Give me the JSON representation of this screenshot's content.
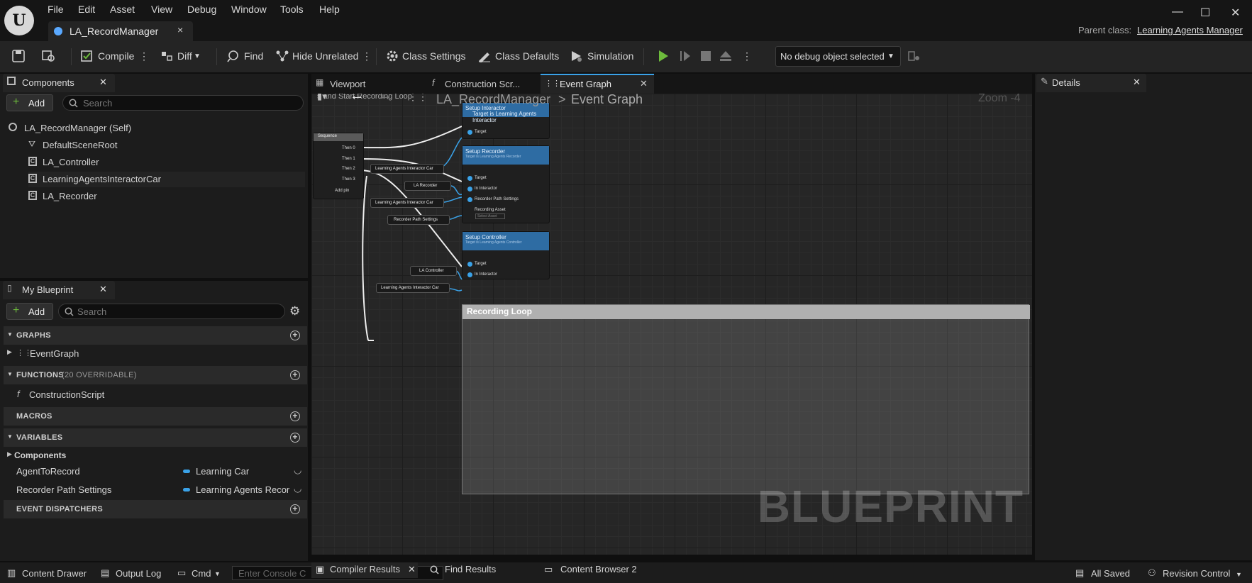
{
  "menu": [
    "File",
    "Edit",
    "Asset",
    "View",
    "Debug",
    "Window",
    "Tools",
    "Help"
  ],
  "doc_tab": {
    "label": "LA_RecordManager",
    "close": "×"
  },
  "parent_class": {
    "label": "Parent class:",
    "value": "Learning Agents Manager"
  },
  "window_buttons": {
    "minimize": "—",
    "maximize": "☐",
    "close": "✕"
  },
  "toolbar": {
    "compile": "Compile",
    "diff": "Diff",
    "find": "Find",
    "hide_unrelated": "Hide Unrelated",
    "class_settings": "Class Settings",
    "class_defaults": "Class Defaults",
    "simulation": "Simulation",
    "debug_object": "No debug object selected"
  },
  "components_panel": {
    "tab": "Components",
    "add": "Add",
    "search_placeholder": "Search",
    "items": [
      "LA_RecordManager (Self)",
      "DefaultSceneRoot",
      "LA_Controller",
      "LearningAgentsInteractorCar",
      "LA_Recorder"
    ]
  },
  "my_blueprint": {
    "tab": "My Blueprint",
    "add": "Add",
    "search_placeholder": "Search",
    "graphs": {
      "header": "GRAPHS",
      "items": [
        "EventGraph"
      ]
    },
    "functions": {
      "header": "FUNCTIONS",
      "count": "(20 OVERRIDABLE)",
      "items": [
        "ConstructionScript"
      ]
    },
    "macros": {
      "header": "MACROS"
    },
    "variables": {
      "header": "VARIABLES",
      "category": "Components",
      "items": [
        {
          "name": "AgentToRecord",
          "type": "Learning Car"
        },
        {
          "name": "Recorder Path Settings",
          "type": "Learning Agents Recor"
        }
      ]
    },
    "dispatchers": {
      "header": "EVENT DISPATCHERS"
    }
  },
  "editor_tabs": [
    {
      "label": "Viewport"
    },
    {
      "label": "Construction Scr..."
    },
    {
      "label": "Event Graph"
    }
  ],
  "details_tab": "Details",
  "graph": {
    "breadcrumb_root": "LA_RecordManager",
    "breadcrumb_sep": ">",
    "breadcrumb_leaf": "Event Graph",
    "zoom": "Zoom -4",
    "comment_fragment": "s and Start Recording Loop",
    "sequence": {
      "title": "Sequence",
      "pins": [
        "Then 0",
        "Then 1",
        "Then 2",
        "Then 3"
      ],
      "add_pin": "Add pin"
    },
    "setup_interactor": {
      "title": "Setup Interactor",
      "subtitle": "Target is Learning Agents Interactor",
      "pins": [
        "Target"
      ]
    },
    "setup_recorder": {
      "title": "Setup Recorder",
      "subtitle": "Target is Learning Agents Recorder",
      "pins": [
        "Target",
        "In Interactor",
        "Recorder Path Settings",
        "Recording Asset"
      ],
      "asset_placeholder": "Select Asset"
    },
    "setup_controller": {
      "title": "Setup Controller",
      "subtitle": "Target is Learning Agents Controller",
      "pins": [
        "Target",
        "In Interactor"
      ]
    },
    "vars": [
      "Learning Agents Interactor Car",
      "LA Recorder",
      "Learning Agents Interactor Car",
      "Recorder Path Settings",
      "LA Controller",
      "Learning Agents Interactor Car"
    ],
    "comment_title": "Recording Loop",
    "watermark": "BLUEPRINT"
  },
  "bottom": {
    "content_drawer": "Content Drawer",
    "output_log": "Output Log",
    "cmd": "Cmd",
    "console_placeholder": "Enter Console C",
    "compiler_results": "Compiler Results",
    "find_results": "Find Results",
    "content_browser": "Content Browser 2",
    "all_saved": "All Saved",
    "revision_control": "Revision Control"
  },
  "colors": {
    "accent_blue": "#3aa2e8",
    "node_header": "#2e6ca3",
    "play_green": "#6dbb3c"
  }
}
